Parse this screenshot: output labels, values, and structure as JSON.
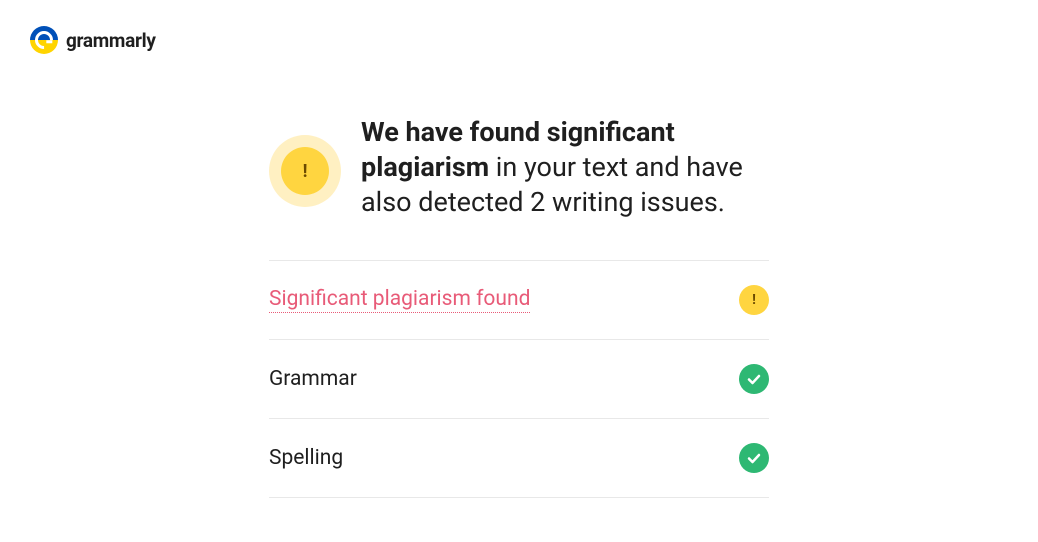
{
  "header": {
    "brand": "grammarly"
  },
  "summary": {
    "text_bold": "We have found significant plagiarism",
    "text_rest": " in your text and have also detected 2 writing issues.",
    "badge_mark": "!"
  },
  "rows": [
    {
      "label": "Significant plagiarism found",
      "status": "warning"
    },
    {
      "label": "Grammar",
      "status": "success"
    },
    {
      "label": "Spelling",
      "status": "success"
    }
  ],
  "icons": {
    "warning_mark": "!"
  }
}
